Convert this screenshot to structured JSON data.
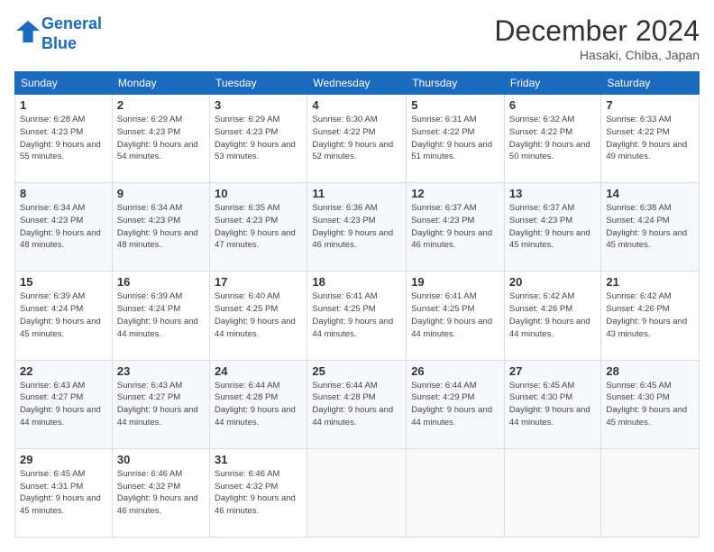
{
  "header": {
    "logo_line1": "General",
    "logo_line2": "Blue",
    "month": "December 2024",
    "location": "Hasaki, Chiba, Japan"
  },
  "days_of_week": [
    "Sunday",
    "Monday",
    "Tuesday",
    "Wednesday",
    "Thursday",
    "Friday",
    "Saturday"
  ],
  "weeks": [
    [
      {
        "day": "1",
        "sunrise": "6:28 AM",
        "sunset": "4:23 PM",
        "daylight": "9 hours and 55 minutes."
      },
      {
        "day": "2",
        "sunrise": "6:29 AM",
        "sunset": "4:23 PM",
        "daylight": "9 hours and 54 minutes."
      },
      {
        "day": "3",
        "sunrise": "6:29 AM",
        "sunset": "4:23 PM",
        "daylight": "9 hours and 53 minutes."
      },
      {
        "day": "4",
        "sunrise": "6:30 AM",
        "sunset": "4:22 PM",
        "daylight": "9 hours and 52 minutes."
      },
      {
        "day": "5",
        "sunrise": "6:31 AM",
        "sunset": "4:22 PM",
        "daylight": "9 hours and 51 minutes."
      },
      {
        "day": "6",
        "sunrise": "6:32 AM",
        "sunset": "4:22 PM",
        "daylight": "9 hours and 50 minutes."
      },
      {
        "day": "7",
        "sunrise": "6:33 AM",
        "sunset": "4:22 PM",
        "daylight": "9 hours and 49 minutes."
      }
    ],
    [
      {
        "day": "8",
        "sunrise": "6:34 AM",
        "sunset": "4:23 PM",
        "daylight": "9 hours and 48 minutes."
      },
      {
        "day": "9",
        "sunrise": "6:34 AM",
        "sunset": "4:23 PM",
        "daylight": "9 hours and 48 minutes."
      },
      {
        "day": "10",
        "sunrise": "6:35 AM",
        "sunset": "4:23 PM",
        "daylight": "9 hours and 47 minutes."
      },
      {
        "day": "11",
        "sunrise": "6:36 AM",
        "sunset": "4:23 PM",
        "daylight": "9 hours and 46 minutes."
      },
      {
        "day": "12",
        "sunrise": "6:37 AM",
        "sunset": "4:23 PM",
        "daylight": "9 hours and 46 minutes."
      },
      {
        "day": "13",
        "sunrise": "6:37 AM",
        "sunset": "4:23 PM",
        "daylight": "9 hours and 45 minutes."
      },
      {
        "day": "14",
        "sunrise": "6:38 AM",
        "sunset": "4:24 PM",
        "daylight": "9 hours and 45 minutes."
      }
    ],
    [
      {
        "day": "15",
        "sunrise": "6:39 AM",
        "sunset": "4:24 PM",
        "daylight": "9 hours and 45 minutes."
      },
      {
        "day": "16",
        "sunrise": "6:39 AM",
        "sunset": "4:24 PM",
        "daylight": "9 hours and 44 minutes."
      },
      {
        "day": "17",
        "sunrise": "6:40 AM",
        "sunset": "4:25 PM",
        "daylight": "9 hours and 44 minutes."
      },
      {
        "day": "18",
        "sunrise": "6:41 AM",
        "sunset": "4:25 PM",
        "daylight": "9 hours and 44 minutes."
      },
      {
        "day": "19",
        "sunrise": "6:41 AM",
        "sunset": "4:25 PM",
        "daylight": "9 hours and 44 minutes."
      },
      {
        "day": "20",
        "sunrise": "6:42 AM",
        "sunset": "4:26 PM",
        "daylight": "9 hours and 44 minutes."
      },
      {
        "day": "21",
        "sunrise": "6:42 AM",
        "sunset": "4:26 PM",
        "daylight": "9 hours and 43 minutes."
      }
    ],
    [
      {
        "day": "22",
        "sunrise": "6:43 AM",
        "sunset": "4:27 PM",
        "daylight": "9 hours and 44 minutes."
      },
      {
        "day": "23",
        "sunrise": "6:43 AM",
        "sunset": "4:27 PM",
        "daylight": "9 hours and 44 minutes."
      },
      {
        "day": "24",
        "sunrise": "6:44 AM",
        "sunset": "4:28 PM",
        "daylight": "9 hours and 44 minutes."
      },
      {
        "day": "25",
        "sunrise": "6:44 AM",
        "sunset": "4:28 PM",
        "daylight": "9 hours and 44 minutes."
      },
      {
        "day": "26",
        "sunrise": "6:44 AM",
        "sunset": "4:29 PM",
        "daylight": "9 hours and 44 minutes."
      },
      {
        "day": "27",
        "sunrise": "6:45 AM",
        "sunset": "4:30 PM",
        "daylight": "9 hours and 44 minutes."
      },
      {
        "day": "28",
        "sunrise": "6:45 AM",
        "sunset": "4:30 PM",
        "daylight": "9 hours and 45 minutes."
      }
    ],
    [
      {
        "day": "29",
        "sunrise": "6:45 AM",
        "sunset": "4:31 PM",
        "daylight": "9 hours and 45 minutes."
      },
      {
        "day": "30",
        "sunrise": "6:46 AM",
        "sunset": "4:32 PM",
        "daylight": "9 hours and 46 minutes."
      },
      {
        "day": "31",
        "sunrise": "6:46 AM",
        "sunset": "4:32 PM",
        "daylight": "9 hours and 46 minutes."
      },
      null,
      null,
      null,
      null
    ]
  ]
}
